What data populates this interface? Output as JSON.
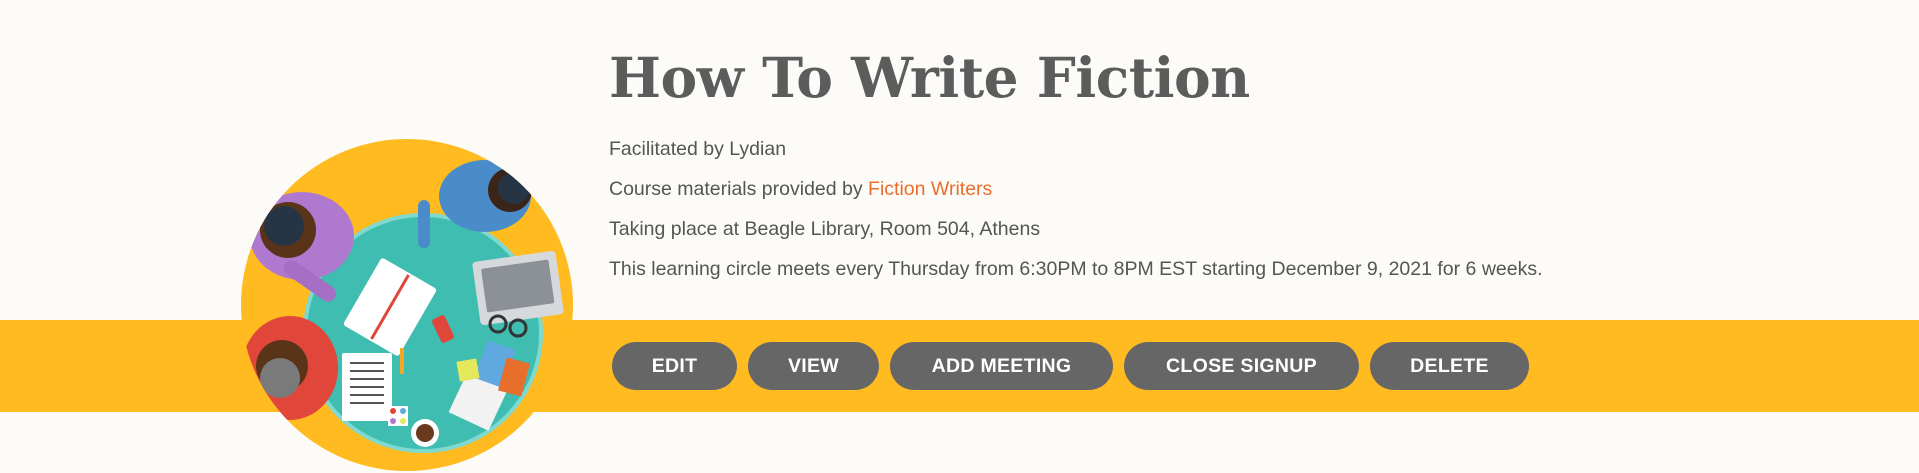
{
  "title": "How To Write Fiction",
  "facilitator": "Facilitated by Lydian",
  "materials": {
    "prefix": "Course materials provided by ",
    "link": "Fiction Writers"
  },
  "location": "Taking place at Beagle Library, Room 504, Athens",
  "schedule": "This learning circle meets every Thursday from 6:30PM to 8PM EST starting December 9, 2021 for 6 weeks.",
  "actions": {
    "edit": "EDIT",
    "view": "VIEW",
    "add_meeting": "ADD MEETING",
    "close_signup": "CLOSE SIGNUP",
    "delete": "DELETE"
  },
  "colors": {
    "band": "#ffbb1f",
    "button": "#666666",
    "link": "#e86e2c",
    "table": "#3ebdb0"
  },
  "illustration": "study-group-table-illustration"
}
